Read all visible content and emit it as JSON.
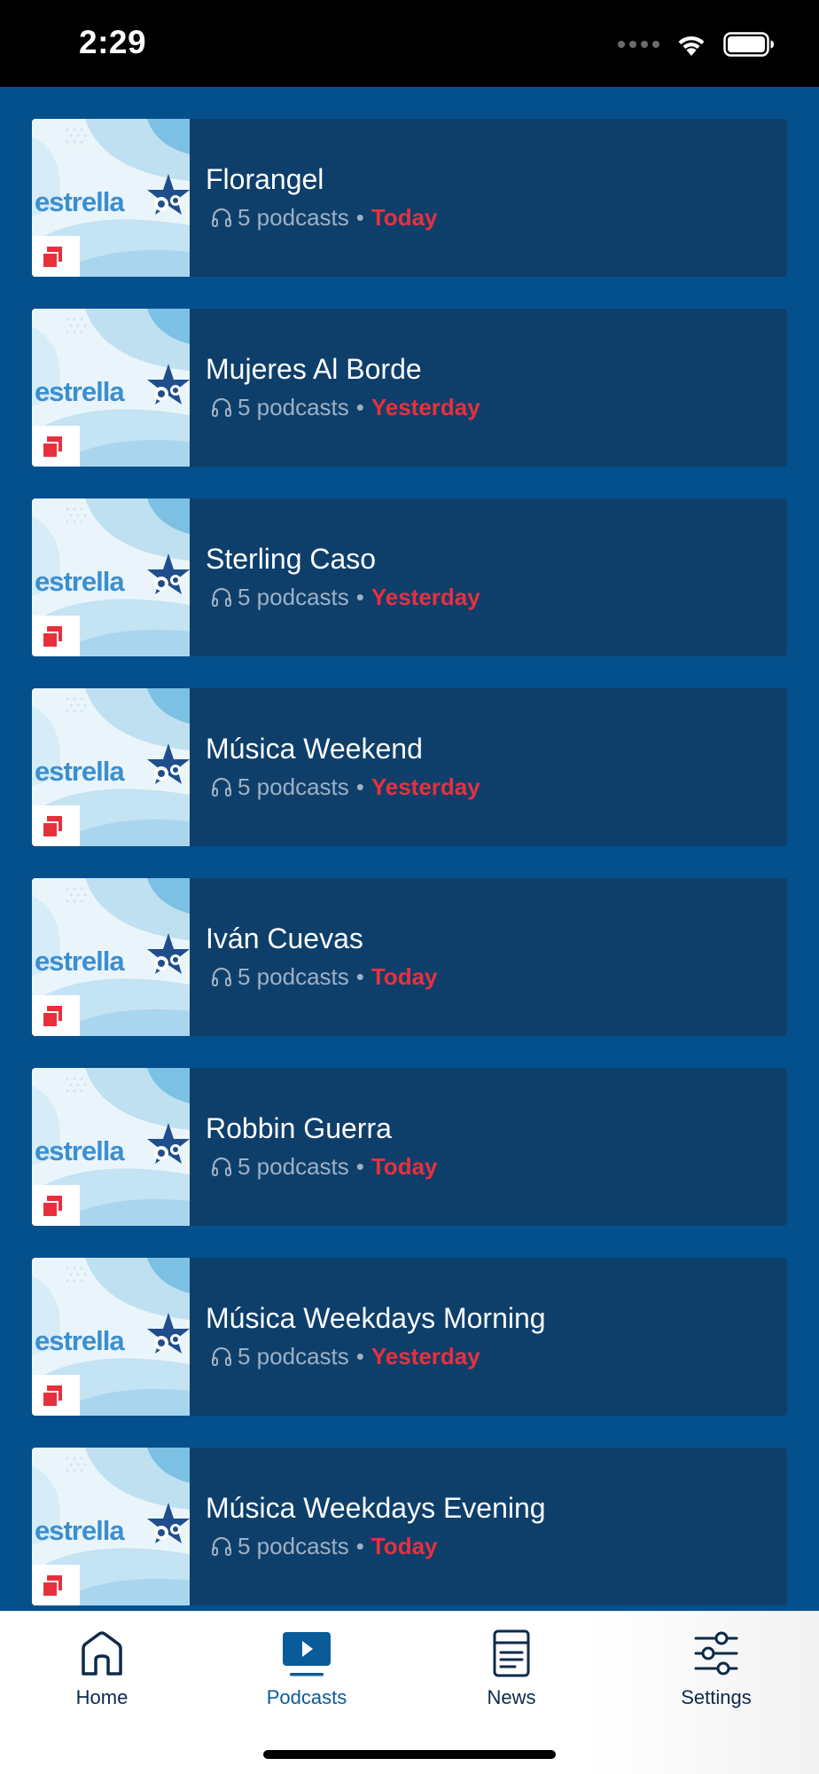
{
  "status_bar": {
    "time": "2:29",
    "icons": [
      "signal-icon",
      "wifi-icon",
      "battery-icon"
    ]
  },
  "podcasts": [
    {
      "title": "Florangel",
      "count": "5 podcasts",
      "date": "Today"
    },
    {
      "title": "Mujeres Al Borde",
      "count": "5 podcasts",
      "date": "Yesterday"
    },
    {
      "title": "Sterling Caso",
      "count": "5 podcasts",
      "date": "Yesterday"
    },
    {
      "title": "Música Weekend",
      "count": "5 podcasts",
      "date": "Yesterday"
    },
    {
      "title": "Iván Cuevas",
      "count": "5 podcasts",
      "date": "Today"
    },
    {
      "title": "Robbin Guerra",
      "count": "5 podcasts",
      "date": "Today"
    },
    {
      "title": "Música Weekdays Morning",
      "count": "5 podcasts",
      "date": "Yesterday"
    },
    {
      "title": "Música Weekdays Evening",
      "count": "5 podcasts",
      "date": "Today"
    }
  ],
  "meta_separator": "•",
  "thumbnail_logo": "estrella",
  "tabs": [
    {
      "label": "Home",
      "icon": "home-icon",
      "active": false
    },
    {
      "label": "Podcasts",
      "icon": "podcasts-icon",
      "active": true
    },
    {
      "label": "News",
      "icon": "news-icon",
      "active": false
    },
    {
      "label": "Settings",
      "icon": "settings-icon",
      "active": false
    }
  ],
  "colors": {
    "list_background": "#04508d",
    "card_background": "#0e3f6b",
    "date_highlight": "#e8303d",
    "active_tab": "#0a5b99"
  }
}
